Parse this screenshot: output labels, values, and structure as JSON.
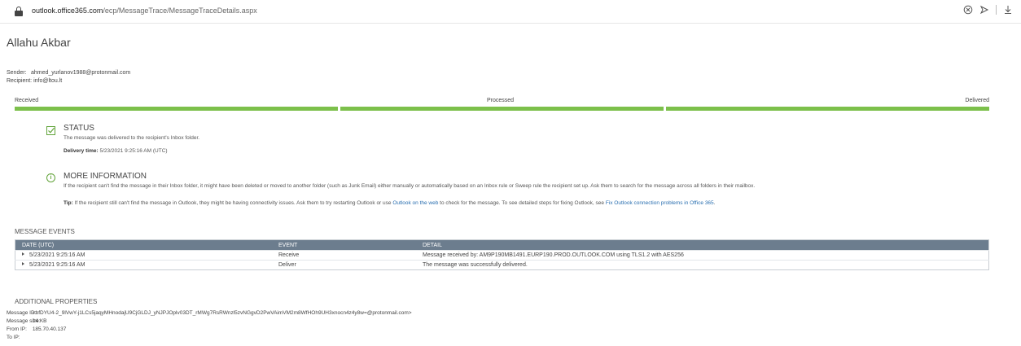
{
  "browser": {
    "url_host": "outlook.office365.com",
    "url_path": "/ecp/MessageTrace/MessageTraceDetails.aspx",
    "icons": [
      "lock-icon",
      "reader-mode-icon",
      "share-icon",
      "download-icon"
    ]
  },
  "page": {
    "title": "Allahu Akbar",
    "sender_label": "Sender:",
    "sender_value": "ahmed_yurlanov1988@protonmail.com",
    "recipient_label": "Recipient:",
    "recipient_value": "info@ltou.lt"
  },
  "progress": {
    "stages": [
      "Received",
      "Processed",
      "Delivered"
    ],
    "completed_fraction": 1.0,
    "color": "#7cc04b"
  },
  "status": {
    "heading": "STATUS",
    "message": "The message was delivered to the recipient's Inbox folder.",
    "delivery_time_label": "Delivery time:",
    "delivery_time_value": "5/23/2021 9:25:16 AM (UTC)"
  },
  "more_info": {
    "heading": "MORE INFORMATION",
    "message": "If the recipient can't find the message in their Inbox folder, it might have been deleted or moved to another folder (such as Junk Email) either manually or automatically based on an Inbox rule or Sweep rule the recipient set up. Ask them to search for the message across all folders in their mailbox.",
    "tip_label": "Tip:",
    "tip_part1": "If the recipient still can't find the message in Outlook, they might be having connectivity issues. Ask them to try restarting Outlook or use",
    "tip_link1": "Outlook on the web",
    "tip_part2": "to check for the message. To see detailed steps for fixing Outlook, see",
    "tip_link2": "Fix Outlook connection problems in Office 365",
    "tip_end": "."
  },
  "events": {
    "heading": "MESSAGE EVENTS",
    "columns": [
      "DATE (UTC)",
      "EVENT",
      "DETAIL"
    ],
    "rows": [
      {
        "date": "5/23/2021 9:25:16 AM",
        "event": "Receive",
        "detail": "Message received by: AM9P190MB1491.EURP190.PROD.OUTLOOK.COM using TLS1.2 with AES256"
      },
      {
        "date": "5/23/2021 9:25:16 AM",
        "event": "Deliver",
        "detail": "The message was successfully delivered."
      }
    ],
    "header_color": "#6c7d8e"
  },
  "properties": {
    "heading": "ADDITIONAL PROPERTIES",
    "items": [
      {
        "label": "Message ID:",
        "value": "<bfDYU4-2_9lVwY-j1LCs5jaqyMHnodajU9CjGLDJ_yNJPJOplv03DT_rMWg7RsRWnzl5zvNGgvD2PwVAimVM2m8WfHOh9UH3xnocn4z4y8w=@protonmail.com>"
      },
      {
        "label": "Message size:",
        "value": "14 KB"
      },
      {
        "label": "From IP:",
        "value": "185.70.40.137"
      },
      {
        "label": "To IP:",
        "value": ""
      }
    ]
  }
}
